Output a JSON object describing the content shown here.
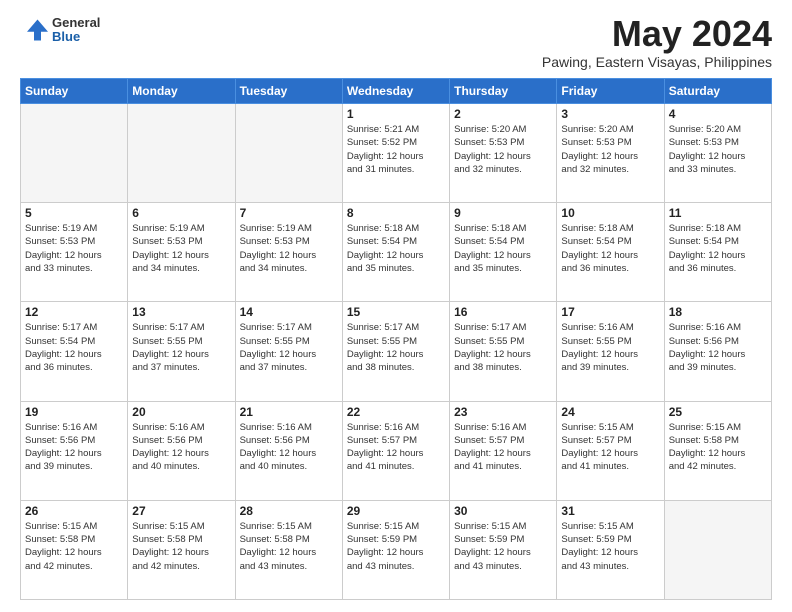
{
  "header": {
    "logo": {
      "general": "General",
      "blue": "Blue"
    },
    "title": "May 2024",
    "location": "Pawing, Eastern Visayas, Philippines"
  },
  "weekdays": [
    "Sunday",
    "Monday",
    "Tuesday",
    "Wednesday",
    "Thursday",
    "Friday",
    "Saturday"
  ],
  "weeks": [
    [
      {
        "day": "",
        "info": ""
      },
      {
        "day": "",
        "info": ""
      },
      {
        "day": "",
        "info": ""
      },
      {
        "day": "1",
        "info": "Sunrise: 5:21 AM\nSunset: 5:52 PM\nDaylight: 12 hours\nand 31 minutes."
      },
      {
        "day": "2",
        "info": "Sunrise: 5:20 AM\nSunset: 5:53 PM\nDaylight: 12 hours\nand 32 minutes."
      },
      {
        "day": "3",
        "info": "Sunrise: 5:20 AM\nSunset: 5:53 PM\nDaylight: 12 hours\nand 32 minutes."
      },
      {
        "day": "4",
        "info": "Sunrise: 5:20 AM\nSunset: 5:53 PM\nDaylight: 12 hours\nand 33 minutes."
      }
    ],
    [
      {
        "day": "5",
        "info": "Sunrise: 5:19 AM\nSunset: 5:53 PM\nDaylight: 12 hours\nand 33 minutes."
      },
      {
        "day": "6",
        "info": "Sunrise: 5:19 AM\nSunset: 5:53 PM\nDaylight: 12 hours\nand 34 minutes."
      },
      {
        "day": "7",
        "info": "Sunrise: 5:19 AM\nSunset: 5:53 PM\nDaylight: 12 hours\nand 34 minutes."
      },
      {
        "day": "8",
        "info": "Sunrise: 5:18 AM\nSunset: 5:54 PM\nDaylight: 12 hours\nand 35 minutes."
      },
      {
        "day": "9",
        "info": "Sunrise: 5:18 AM\nSunset: 5:54 PM\nDaylight: 12 hours\nand 35 minutes."
      },
      {
        "day": "10",
        "info": "Sunrise: 5:18 AM\nSunset: 5:54 PM\nDaylight: 12 hours\nand 36 minutes."
      },
      {
        "day": "11",
        "info": "Sunrise: 5:18 AM\nSunset: 5:54 PM\nDaylight: 12 hours\nand 36 minutes."
      }
    ],
    [
      {
        "day": "12",
        "info": "Sunrise: 5:17 AM\nSunset: 5:54 PM\nDaylight: 12 hours\nand 36 minutes."
      },
      {
        "day": "13",
        "info": "Sunrise: 5:17 AM\nSunset: 5:55 PM\nDaylight: 12 hours\nand 37 minutes."
      },
      {
        "day": "14",
        "info": "Sunrise: 5:17 AM\nSunset: 5:55 PM\nDaylight: 12 hours\nand 37 minutes."
      },
      {
        "day": "15",
        "info": "Sunrise: 5:17 AM\nSunset: 5:55 PM\nDaylight: 12 hours\nand 38 minutes."
      },
      {
        "day": "16",
        "info": "Sunrise: 5:17 AM\nSunset: 5:55 PM\nDaylight: 12 hours\nand 38 minutes."
      },
      {
        "day": "17",
        "info": "Sunrise: 5:16 AM\nSunset: 5:55 PM\nDaylight: 12 hours\nand 39 minutes."
      },
      {
        "day": "18",
        "info": "Sunrise: 5:16 AM\nSunset: 5:56 PM\nDaylight: 12 hours\nand 39 minutes."
      }
    ],
    [
      {
        "day": "19",
        "info": "Sunrise: 5:16 AM\nSunset: 5:56 PM\nDaylight: 12 hours\nand 39 minutes."
      },
      {
        "day": "20",
        "info": "Sunrise: 5:16 AM\nSunset: 5:56 PM\nDaylight: 12 hours\nand 40 minutes."
      },
      {
        "day": "21",
        "info": "Sunrise: 5:16 AM\nSunset: 5:56 PM\nDaylight: 12 hours\nand 40 minutes."
      },
      {
        "day": "22",
        "info": "Sunrise: 5:16 AM\nSunset: 5:57 PM\nDaylight: 12 hours\nand 41 minutes."
      },
      {
        "day": "23",
        "info": "Sunrise: 5:16 AM\nSunset: 5:57 PM\nDaylight: 12 hours\nand 41 minutes."
      },
      {
        "day": "24",
        "info": "Sunrise: 5:15 AM\nSunset: 5:57 PM\nDaylight: 12 hours\nand 41 minutes."
      },
      {
        "day": "25",
        "info": "Sunrise: 5:15 AM\nSunset: 5:58 PM\nDaylight: 12 hours\nand 42 minutes."
      }
    ],
    [
      {
        "day": "26",
        "info": "Sunrise: 5:15 AM\nSunset: 5:58 PM\nDaylight: 12 hours\nand 42 minutes."
      },
      {
        "day": "27",
        "info": "Sunrise: 5:15 AM\nSunset: 5:58 PM\nDaylight: 12 hours\nand 42 minutes."
      },
      {
        "day": "28",
        "info": "Sunrise: 5:15 AM\nSunset: 5:58 PM\nDaylight: 12 hours\nand 43 minutes."
      },
      {
        "day": "29",
        "info": "Sunrise: 5:15 AM\nSunset: 5:59 PM\nDaylight: 12 hours\nand 43 minutes."
      },
      {
        "day": "30",
        "info": "Sunrise: 5:15 AM\nSunset: 5:59 PM\nDaylight: 12 hours\nand 43 minutes."
      },
      {
        "day": "31",
        "info": "Sunrise: 5:15 AM\nSunset: 5:59 PM\nDaylight: 12 hours\nand 43 minutes."
      },
      {
        "day": "",
        "info": ""
      }
    ]
  ]
}
